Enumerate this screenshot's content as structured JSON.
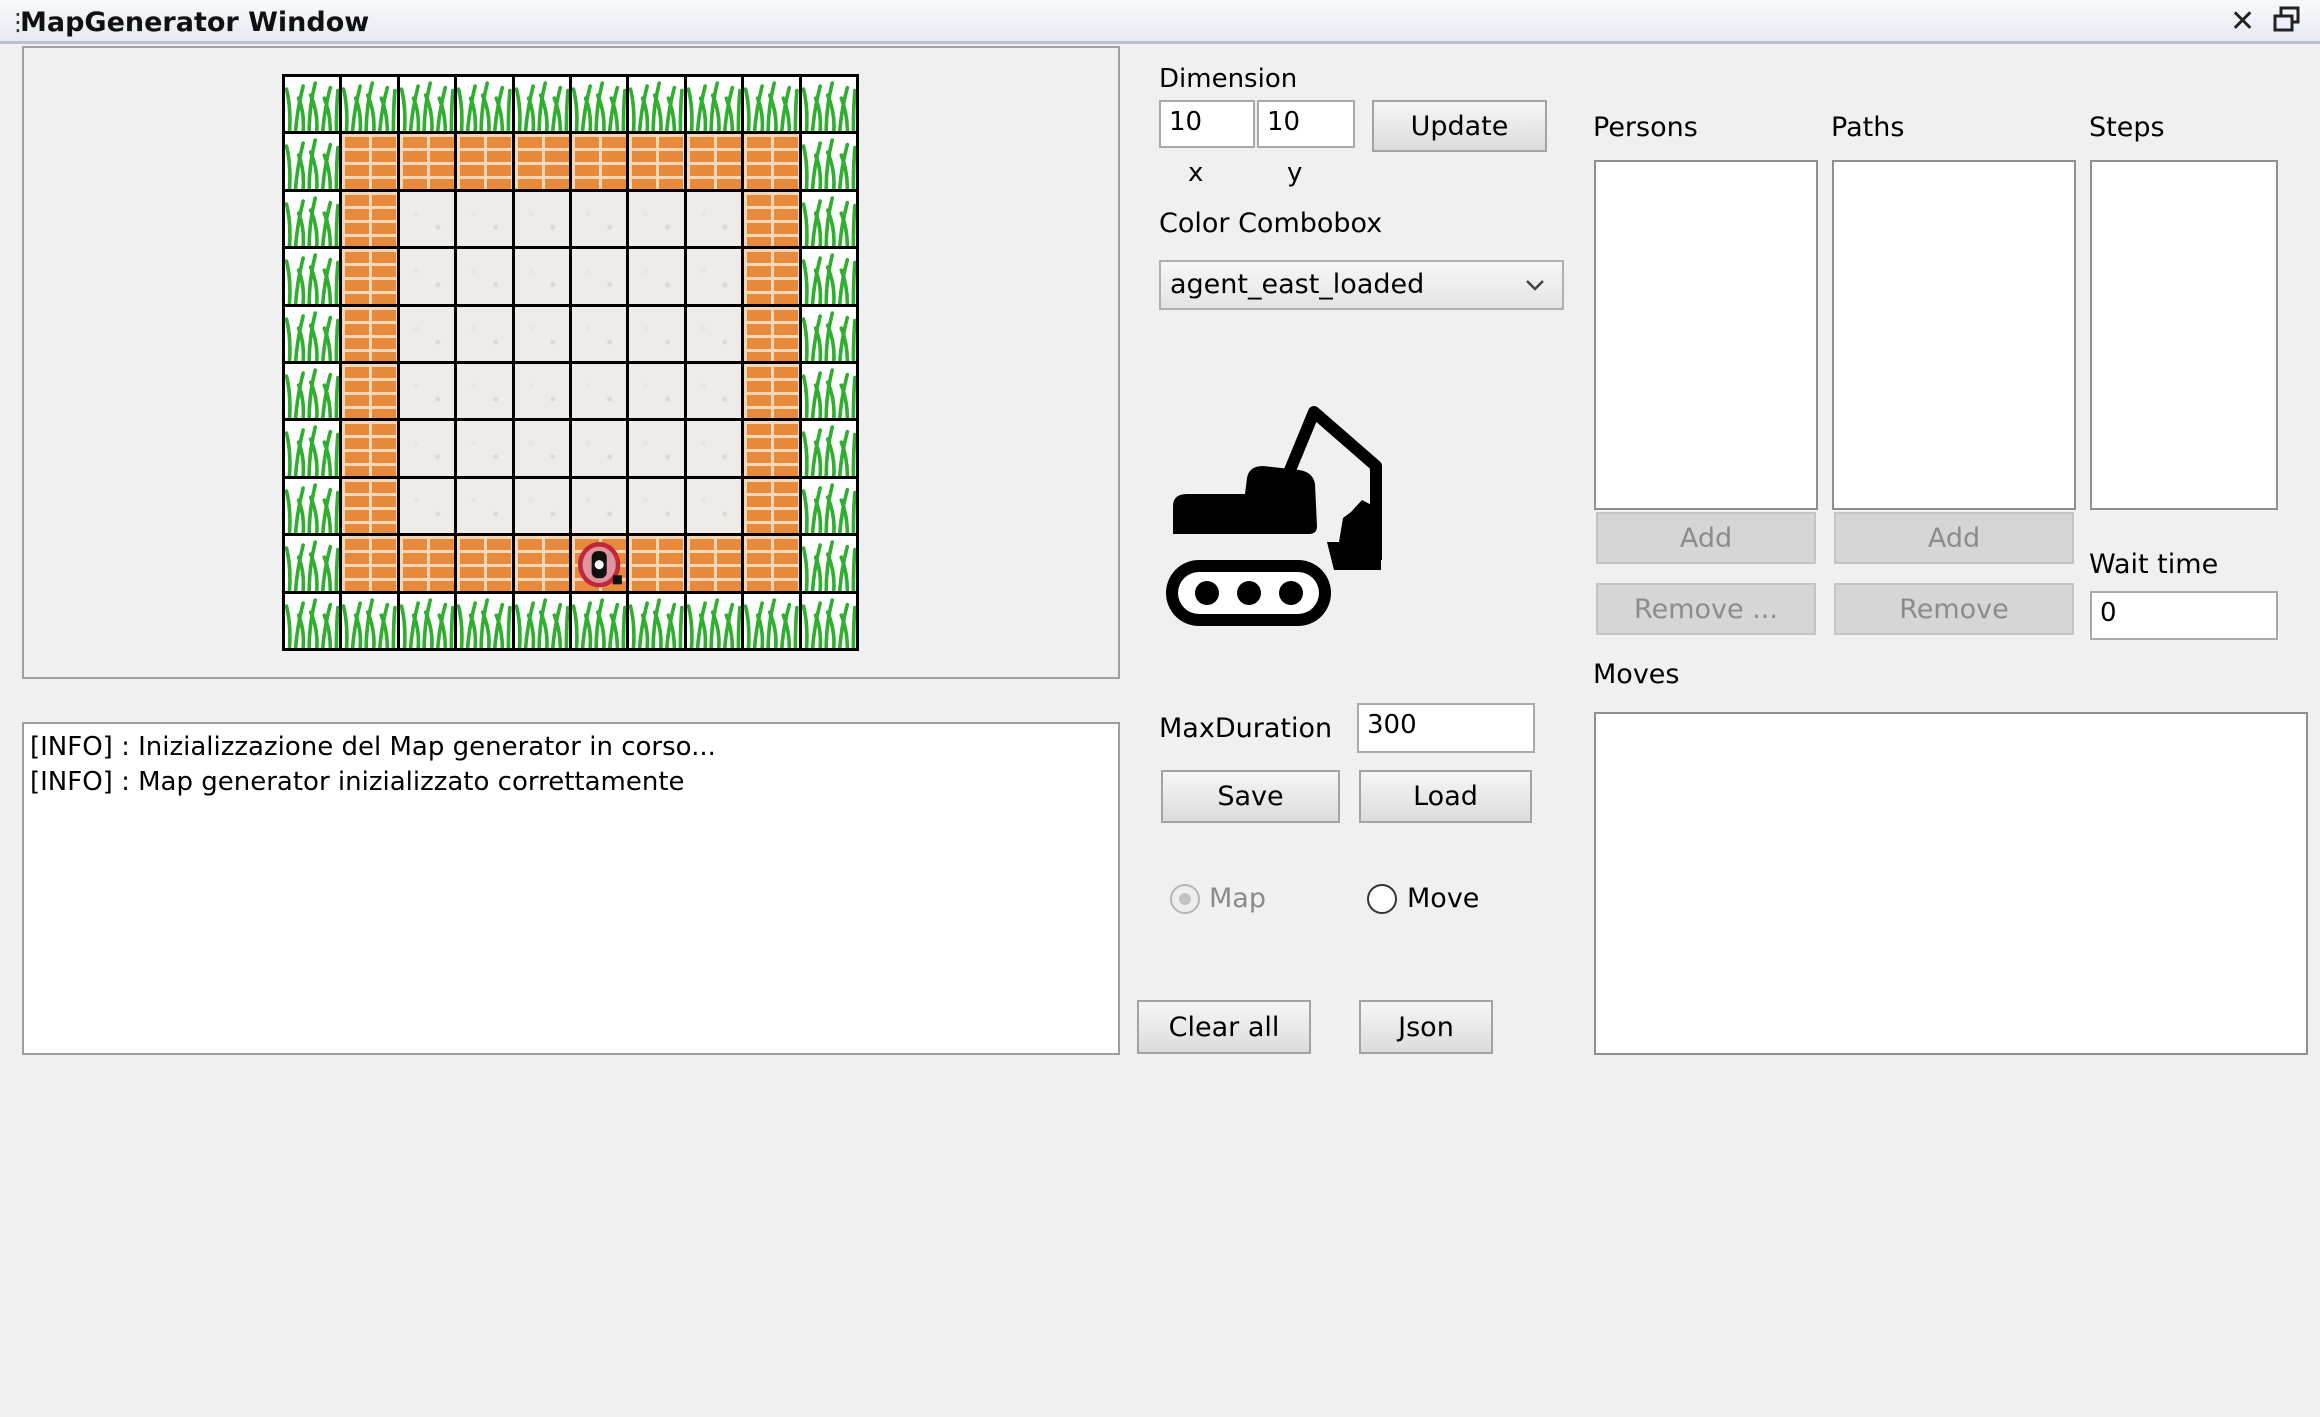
{
  "window": {
    "title": "MapGenerator Window",
    "grip_icon": "grip-icon",
    "close_icon": "close-icon",
    "restore_icon": "restore-icon"
  },
  "map": {
    "rows": 10,
    "cols": 10,
    "cells": [
      [
        "grass",
        "grass",
        "grass",
        "grass",
        "grass",
        "grass",
        "grass",
        "grass",
        "grass",
        "grass"
      ],
      [
        "grass",
        "wall",
        "wall",
        "wall",
        "wall",
        "wall",
        "wall",
        "wall",
        "wall",
        "grass"
      ],
      [
        "grass",
        "wall",
        "floor",
        "floor",
        "floor",
        "floor",
        "floor",
        "floor",
        "wall",
        "grass"
      ],
      [
        "grass",
        "wall",
        "floor",
        "floor",
        "floor",
        "floor",
        "floor",
        "floor",
        "wall",
        "grass"
      ],
      [
        "grass",
        "wall",
        "floor",
        "floor",
        "floor",
        "floor",
        "floor",
        "floor",
        "wall",
        "grass"
      ],
      [
        "grass",
        "wall",
        "floor",
        "floor",
        "floor",
        "floor",
        "floor",
        "floor",
        "wall",
        "grass"
      ],
      [
        "grass",
        "wall",
        "floor",
        "floor",
        "floor",
        "floor",
        "floor",
        "floor",
        "wall",
        "grass"
      ],
      [
        "grass",
        "wall",
        "floor",
        "floor",
        "floor",
        "floor",
        "floor",
        "floor",
        "wall",
        "grass"
      ],
      [
        "grass",
        "wall",
        "wall",
        "wall",
        "wall",
        "agent",
        "wall",
        "wall",
        "wall",
        "grass"
      ],
      [
        "grass",
        "grass",
        "grass",
        "grass",
        "grass",
        "grass",
        "grass",
        "grass",
        "grass",
        "grass"
      ]
    ],
    "colors": {
      "grass": "#2fae2f",
      "wall": "#e88a3c",
      "floor": "#eeebe8",
      "agent": "#c0283a"
    }
  },
  "dimension": {
    "label": "Dimension",
    "x_value": "10",
    "y_value": "10",
    "x_label": "x",
    "y_label": "y",
    "update_label": "Update"
  },
  "color_combobox": {
    "label": "Color Combobox",
    "selected": "agent_east_loaded",
    "preview_icon": "excavator-icon"
  },
  "log": {
    "lines": [
      "[INFO] : Inizializzazione del Map generator in corso...",
      "[INFO] : Map generator inizializzato correttamente"
    ]
  },
  "controls": {
    "max_duration_label": "MaxDuration",
    "max_duration_value": "300",
    "save_label": "Save",
    "load_label": "Load",
    "radio_map_label": "Map",
    "radio_move_label": "Move",
    "clear_all_label": "Clear all",
    "json_label": "Json"
  },
  "persons": {
    "label": "Persons",
    "add_label": "Add",
    "remove_label": "Remove ..."
  },
  "paths": {
    "label": "Paths",
    "add_label": "Add",
    "remove_label": "Remove"
  },
  "steps": {
    "label": "Steps",
    "wait_time_label": "Wait time",
    "wait_time_value": "0"
  },
  "moves": {
    "label": "Moves"
  }
}
